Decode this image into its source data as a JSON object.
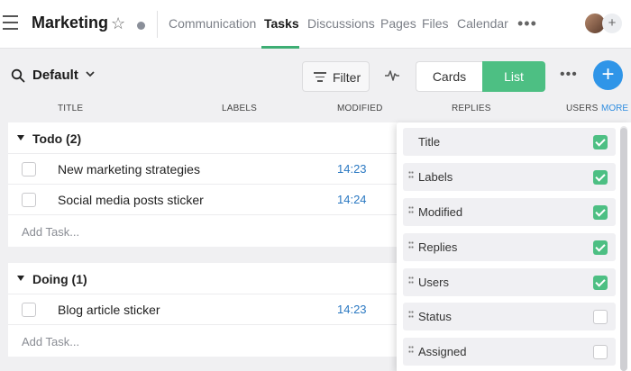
{
  "header": {
    "workspace_title": "Marketing",
    "tabs": [
      {
        "label": "Communication",
        "active": false
      },
      {
        "label": "Tasks",
        "active": true
      },
      {
        "label": "Discussions",
        "active": false
      },
      {
        "label": "Pages",
        "active": false
      },
      {
        "label": "Files",
        "active": false
      },
      {
        "label": "Calendar",
        "active": false
      }
    ],
    "add_member_label": "+"
  },
  "toolbar": {
    "view_name": "Default",
    "filter_label": "Filter",
    "cards_label": "Cards",
    "list_label": "List",
    "add_label": "+"
  },
  "columns": {
    "title": "TITLE",
    "labels": "LABELS",
    "modified": "MODIFIED",
    "replies": "REPLIES",
    "users": "USERS",
    "more": "MORE"
  },
  "groups": [
    {
      "title": "Todo (2)",
      "tasks": [
        {
          "title": "New marketing strategies",
          "modified": "14:23"
        },
        {
          "title": "Social media posts sticker",
          "modified": "14:24"
        }
      ],
      "add_label": "Add Task..."
    },
    {
      "title": "Doing (1)",
      "tasks": [
        {
          "title": "Blog article sticker",
          "modified": "14:23"
        }
      ],
      "add_label": "Add Task..."
    }
  ],
  "column_picker": [
    {
      "label": "Title",
      "checked": true,
      "draggable": false
    },
    {
      "label": "Labels",
      "checked": true,
      "draggable": true
    },
    {
      "label": "Modified",
      "checked": true,
      "draggable": true
    },
    {
      "label": "Replies",
      "checked": true,
      "draggable": true
    },
    {
      "label": "Users",
      "checked": true,
      "draggable": true
    },
    {
      "label": "Status",
      "checked": false,
      "draggable": true
    },
    {
      "label": "Assigned",
      "checked": false,
      "draggable": true
    }
  ],
  "colors": {
    "accent_green": "#4dbf83",
    "tab_underline": "#3eae74",
    "primary_blue": "#2f95e8",
    "time_blue": "#2a78c2"
  }
}
